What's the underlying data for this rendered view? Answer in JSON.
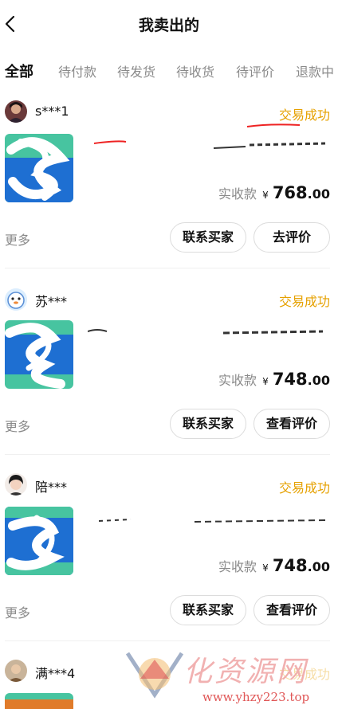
{
  "header": {
    "title": "我卖出的"
  },
  "tabs": [
    {
      "label": "全部",
      "active": true
    },
    {
      "label": "待付款"
    },
    {
      "label": "待发货"
    },
    {
      "label": "待收货"
    },
    {
      "label": "待评价"
    },
    {
      "label": "退款中"
    }
  ],
  "colors": {
    "accent": "#e6a100",
    "tab_underline": "#ffd83a",
    "thumb_green": "#47c4a0",
    "thumb_blue": "#1e6fd2"
  },
  "orders": [
    {
      "buyer": "s***1",
      "status": "交易成功",
      "pay_label": "实收款",
      "currency": "¥",
      "price_int": "768",
      "price_dec": ".00",
      "more": "更多",
      "btn_contact": "联系买家",
      "btn_review": "去评价"
    },
    {
      "buyer": "苏***",
      "status": "交易成功",
      "pay_label": "实收款",
      "currency": "¥",
      "price_int": "748",
      "price_dec": ".00",
      "more": "更多",
      "btn_contact": "联系买家",
      "btn_review": "查看评价"
    },
    {
      "buyer": "陪***",
      "status": "交易成功",
      "pay_label": "实收款",
      "currency": "¥",
      "price_int": "748",
      "price_dec": ".00",
      "more": "更多",
      "btn_contact": "联系买家",
      "btn_review": "查看评价"
    },
    {
      "buyer": "满***4",
      "status": "交易成功"
    }
  ],
  "watermark": {
    "text": "化资源网",
    "url": "www.yhzy223.top"
  }
}
